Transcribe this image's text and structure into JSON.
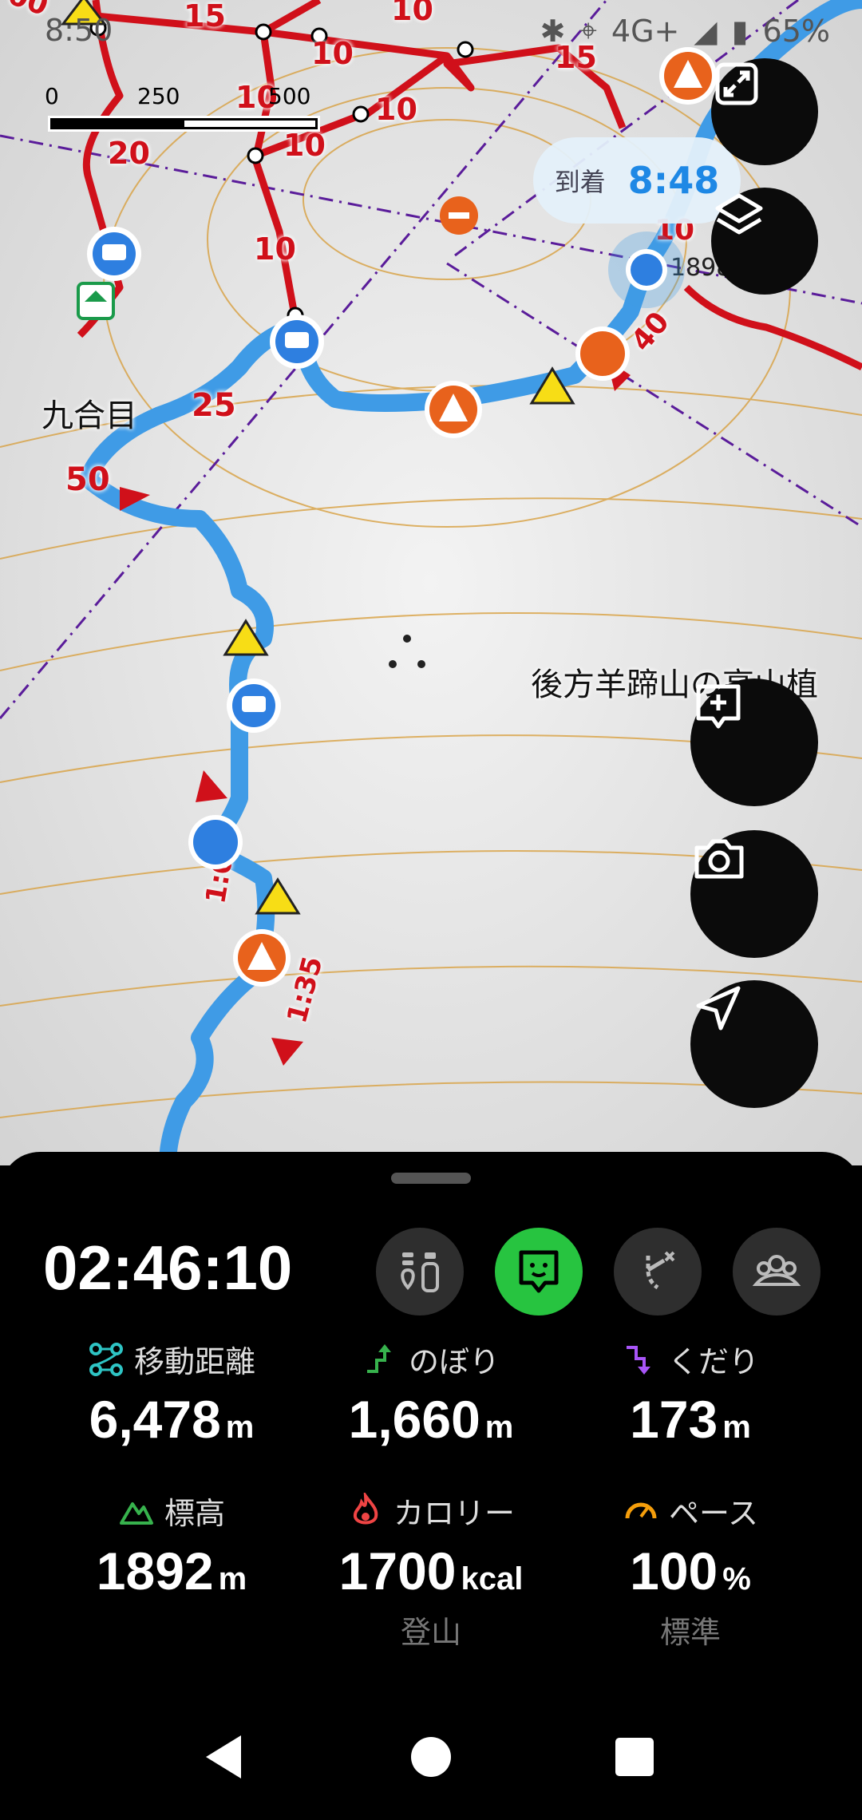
{
  "status_bar": {
    "time": "8:50",
    "network": "4G+",
    "battery": "65%"
  },
  "scale": {
    "zero": "0",
    "mid": "250 m",
    "end": "500 m"
  },
  "arrival": {
    "label": "到着",
    "time": "8:48"
  },
  "map": {
    "labels": {
      "station": "九合目",
      "place": "後方羊蹄山の高山植",
      "elevation_marker": "1898"
    },
    "route_numbers": [
      "15",
      "10",
      "10",
      "10",
      "10",
      "15",
      "20",
      "10",
      "10",
      "25",
      "50",
      "40",
      "10",
      "00"
    ],
    "time_marks": [
      "1:00",
      "1:35"
    ]
  },
  "panel": {
    "elapsed": "02:46:10",
    "modes": [
      "transit-map-icon",
      "speech-face-icon",
      "route-branch-icon",
      "group-icon"
    ],
    "stats": [
      {
        "label": "移動距離",
        "value": "6,478",
        "unit": "m",
        "sub": "",
        "icon": "distance-icon",
        "color": "#2ec4c4"
      },
      {
        "label": "のぼり",
        "value": "1,660",
        "unit": "m",
        "sub": "",
        "icon": "ascent-icon",
        "color": "#37b24d"
      },
      {
        "label": "くだり",
        "value": "173",
        "unit": "m",
        "sub": "",
        "icon": "descent-icon",
        "color": "#a855f7"
      },
      {
        "label": "標高",
        "value": "1892",
        "unit": "m",
        "sub": "",
        "icon": "mountain-icon",
        "color": "#37b24d"
      },
      {
        "label": "カロリー",
        "value": "1700",
        "unit": "kcal",
        "sub": "登山",
        "icon": "flame-icon",
        "color": "#ef4444"
      },
      {
        "label": "ペース",
        "value": "100",
        "unit": "%",
        "sub": "標準",
        "icon": "gauge-icon",
        "color": "#f59e0b"
      }
    ]
  },
  "colors": {
    "route_blue": "#3f9be6",
    "trail_red": "#d0101a",
    "accent_green": "#27c440",
    "contour": "#d8a040"
  }
}
